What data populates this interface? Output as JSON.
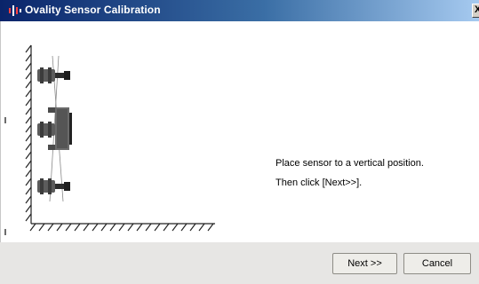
{
  "window": {
    "title": "Ovality Sensor Calibration",
    "close_label": "X"
  },
  "instructions": {
    "line1": "Place sensor to a vertical position.",
    "line2": "Then click [Next>>]."
  },
  "buttons": {
    "next_label": "Next >>",
    "cancel_label": "Cancel"
  },
  "icons": {
    "app": "ovality-app-icon",
    "close": "close-icon",
    "diagram": "vertical-sensor-position-illustration"
  },
  "colors": {
    "titlebar_start": "#0a246a",
    "titlebar_end": "#a6caf0",
    "footer": "#e7e6e4"
  }
}
